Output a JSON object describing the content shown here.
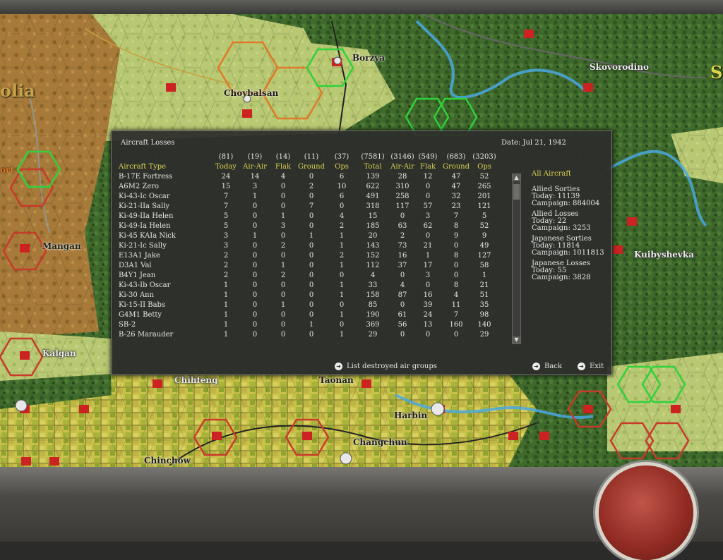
{
  "map": {
    "labels": {
      "olia": "olia",
      "ort": "ort",
      "choybalsan": "Choybalsan",
      "borzya": "Borzya",
      "skovorodino": "Skovorodino",
      "mangan": "Mangan",
      "kuibyshevka": "Kuibyshevka",
      "kalgan": "Kalgan",
      "chihfeng": "Chihfeng",
      "taonan": "Taonan",
      "harbin": "Harbin",
      "changchun": "Changchun",
      "chinchow": "Chinchow",
      "edge_s": "S"
    }
  },
  "dialog": {
    "title": "Aircraft Losses",
    "date": "Date: Jul 21, 1942",
    "totals_row": [
      "",
      "(81)",
      "(19)",
      "(14)",
      "(11)",
      "(37)",
      "(7581)",
      "(3146)",
      "(549)",
      "(683)",
      "(3203)"
    ],
    "headers": [
      "Aircraft Type",
      "Today",
      "Air-Air",
      "Flak",
      "Ground",
      "Ops",
      "Total",
      "Air-Air",
      "Flak",
      "Ground",
      "Ops"
    ],
    "rows": [
      [
        "B-17E Fortress",
        "24",
        "14",
        "4",
        "0",
        "6",
        "139",
        "28",
        "12",
        "47",
        "52"
      ],
      [
        "A6M2 Zero",
        "15",
        "3",
        "0",
        "2",
        "10",
        "622",
        "310",
        "0",
        "47",
        "265"
      ],
      [
        "Ki-43-Ic Oscar",
        "7",
        "1",
        "0",
        "0",
        "6",
        "491",
        "258",
        "0",
        "32",
        "201"
      ],
      [
        "Ki-21-IIa Sally",
        "7",
        "0",
        "0",
        "7",
        "0",
        "318",
        "117",
        "57",
        "23",
        "121"
      ],
      [
        "Ki-49-IIa Helen",
        "5",
        "0",
        "1",
        "0",
        "4",
        "15",
        "0",
        "3",
        "7",
        "5"
      ],
      [
        "Ki-49-Ia Helen",
        "5",
        "0",
        "3",
        "0",
        "2",
        "185",
        "63",
        "62",
        "8",
        "52"
      ],
      [
        "Ki-45 KAIa Nick",
        "3",
        "1",
        "0",
        "1",
        "1",
        "20",
        "2",
        "0",
        "9",
        "9"
      ],
      [
        "Ki-21-Ic Sally",
        "3",
        "0",
        "2",
        "0",
        "1",
        "143",
        "73",
        "21",
        "0",
        "49"
      ],
      [
        "E13A1 Jake",
        "2",
        "0",
        "0",
        "0",
        "2",
        "152",
        "16",
        "1",
        "8",
        "127"
      ],
      [
        "D3A1 Val",
        "2",
        "0",
        "1",
        "0",
        "1",
        "112",
        "37",
        "17",
        "0",
        "58"
      ],
      [
        "B4Y1 Jean",
        "2",
        "0",
        "2",
        "0",
        "0",
        "4",
        "0",
        "3",
        "0",
        "1"
      ],
      [
        "Ki-43-Ib Oscar",
        "1",
        "0",
        "0",
        "0",
        "1",
        "33",
        "4",
        "0",
        "8",
        "21"
      ],
      [
        "Ki-30 Ann",
        "1",
        "0",
        "0",
        "0",
        "1",
        "158",
        "87",
        "16",
        "4",
        "51"
      ],
      [
        "Ki-15-II Babs",
        "1",
        "0",
        "1",
        "0",
        "0",
        "85",
        "0",
        "39",
        "11",
        "35"
      ],
      [
        "G4M1 Betty",
        "1",
        "0",
        "0",
        "0",
        "1",
        "190",
        "61",
        "24",
        "7",
        "98"
      ],
      [
        "SB-2",
        "1",
        "0",
        "0",
        "1",
        "0",
        "369",
        "56",
        "13",
        "160",
        "140"
      ],
      [
        "B-26 Marauder",
        "1",
        "0",
        "0",
        "0",
        "1",
        "29",
        "0",
        "0",
        "0",
        "29"
      ]
    ],
    "side": {
      "filter": "All Aircraft",
      "allied_sorties_title": "Allied Sorties",
      "allied_sorties_today": "Today:  11139",
      "allied_sorties_campaign": "Campaign: 884004",
      "allied_losses_title": "Allied Losses",
      "allied_losses_today": "Today:  22",
      "allied_losses_campaign": "Campaign: 3253",
      "japanese_sorties_title": "Japanese Sorties",
      "japanese_sorties_today": "Today:  11814",
      "japanese_sorties_campaign": "Campaign: 1011813",
      "japanese_losses_title": "Japanese Losses",
      "japanese_losses_today": "Today:  55",
      "japanese_losses_campaign": "Campaign: 3828"
    },
    "buttons": {
      "list_destroyed": "List destroyed air groups",
      "back": "Back",
      "exit": "Exit"
    }
  },
  "colors": {
    "accent_yellow": "#d9cf52",
    "soviet_red": "#cc2222",
    "hex_red": "#c83a2a",
    "hex_orange": "#e07a28",
    "hex_green": "#2fd23a",
    "river_blue": "#4aa8e0"
  }
}
